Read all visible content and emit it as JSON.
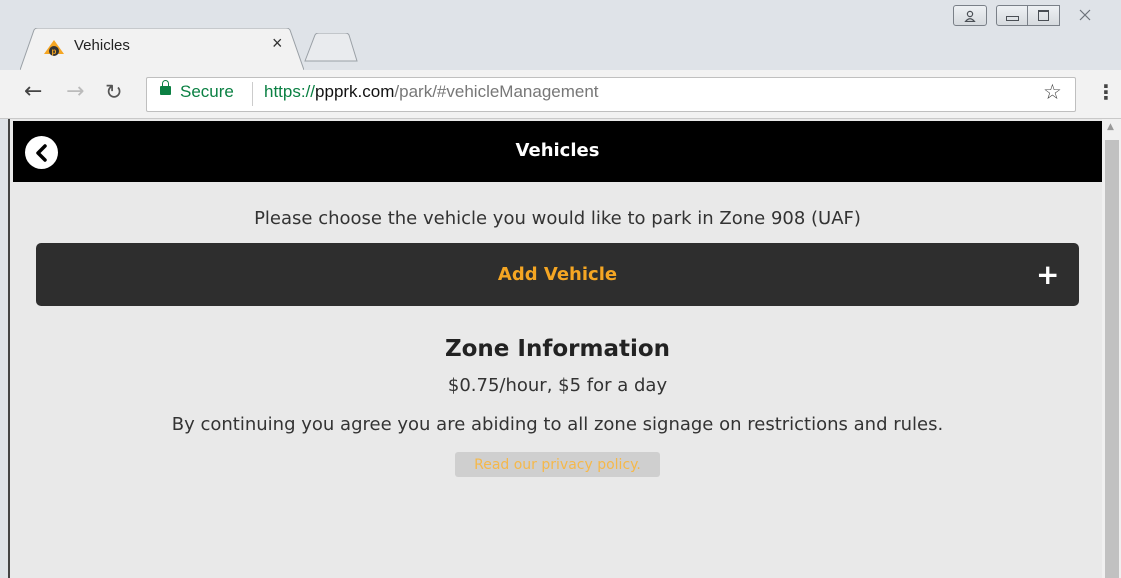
{
  "browser": {
    "tab_title": "Vehicles",
    "tab_close": "×",
    "secure_label": "Secure",
    "url_scheme": "https://",
    "url_host": "ppprk.com",
    "url_path": "/park/#vehicleManagement",
    "colors": {
      "secure": "#0b8043",
      "chrome": "#dfe3e8"
    }
  },
  "page": {
    "header_title": "Vehicles",
    "prompt": "Please choose the vehicle you would like to park in Zone 908 (UAF)",
    "add_vehicle_label": "Add Vehicle",
    "add_icon": "plus-icon",
    "zone": {
      "title": "Zone Information",
      "rate": "$0.75/hour, $5 for a day",
      "agreement": "By continuing you agree you are abiding to all zone signage on restrictions and rules."
    },
    "privacy_link": "Read our privacy policy.",
    "colors": {
      "accent": "#f5a623",
      "header_bg": "#000000",
      "button_bg": "#2e2e2e"
    }
  }
}
